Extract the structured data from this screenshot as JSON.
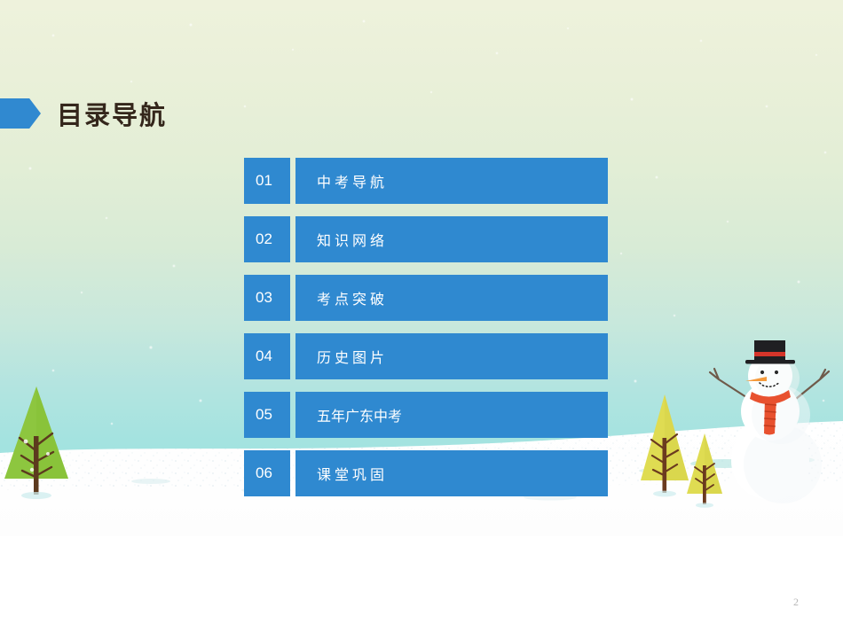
{
  "slide": {
    "page_number": "2",
    "background_theme": "winter-snow-scene",
    "colors": {
      "accent_blue": "#2f89d0",
      "title_text": "#34261b",
      "sky_top": "#eef2dc",
      "sky_bottom": "#9ce1de",
      "snow_white": "#ffffff",
      "tree_green": "#8cc63f",
      "tree_yellow": "#dcdc54",
      "trunk_brown": "#6b3d24",
      "scarf_red": "#e8512f",
      "carrot_orange": "#f59a3c",
      "hat_black": "#1f1f22",
      "page_number_gray": "#b6b6b6"
    }
  },
  "header": {
    "title": "目录导航",
    "arrow_icon": "pentagon-arrow-right-icon"
  },
  "menu": {
    "items": [
      {
        "number": "01",
        "label": "中考导航",
        "spaced": true
      },
      {
        "number": "02",
        "label": "知识网络",
        "spaced": true
      },
      {
        "number": "03",
        "label": "考点突破",
        "spaced": true
      },
      {
        "number": "04",
        "label": "历史图片",
        "spaced": true
      },
      {
        "number": "05",
        "label": "五年广东中考",
        "spaced": false
      },
      {
        "number": "06",
        "label": "课堂巩固",
        "spaced": true
      }
    ]
  },
  "illustration": {
    "elements": [
      "snow-ground",
      "pine-tree-green-left",
      "pine-tree-yellow-large",
      "pine-tree-yellow-small",
      "snowman"
    ],
    "snowman": {
      "hat": "top-hat",
      "hat_band": "red",
      "nose": "carrot",
      "scarf": "red-striped-scarf",
      "arms": "stick-arms",
      "eyes": "coal-dots",
      "mouth": "coal-dot-smile"
    }
  }
}
